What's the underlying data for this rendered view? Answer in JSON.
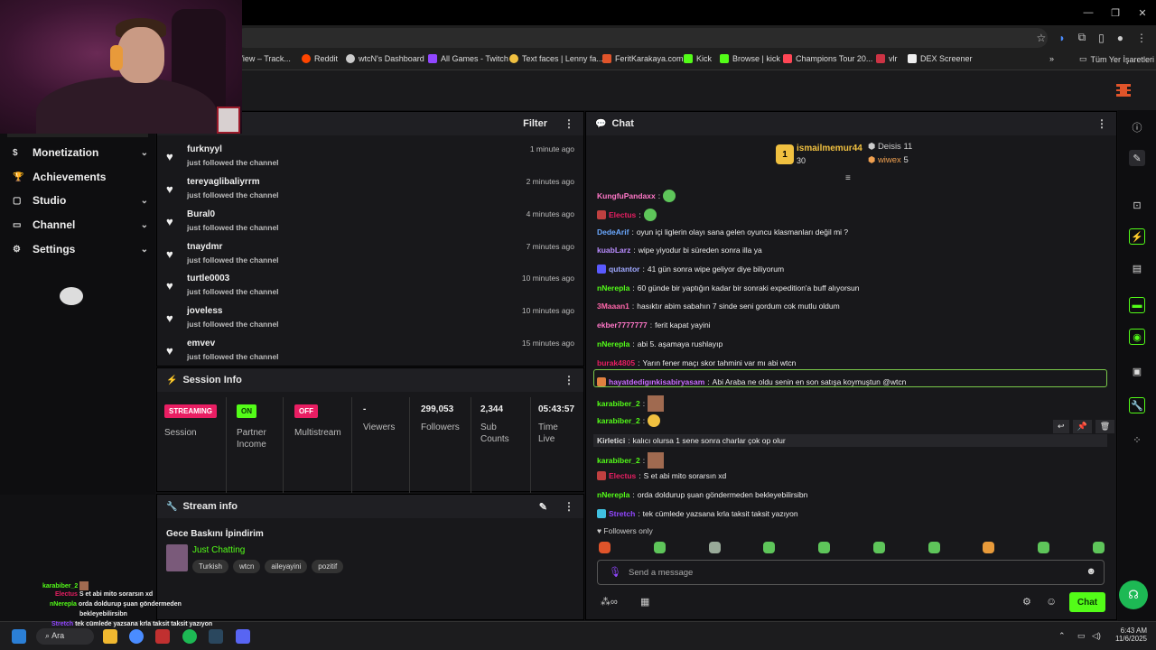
{
  "browser": {
    "bookmarks": [
      {
        "label": "gView – Track...",
        "color": "#888888"
      },
      {
        "label": "Reddit",
        "color": "#ff4500"
      },
      {
        "label": "wtcN's Dashboard",
        "color": "#ffffff"
      },
      {
        "label": "All Games - Twitch",
        "color": "#9146ff"
      },
      {
        "label": "Text faces | Lenny fa...",
        "color": "#f0c040"
      },
      {
        "label": "FeritKarakaya.com",
        "color": "#e0542a"
      },
      {
        "label": "Kick",
        "color": "#53fc18"
      },
      {
        "label": "Browse | kick",
        "color": "#53fc18"
      },
      {
        "label": "Champions Tour 20...",
        "color": "#ff4655"
      },
      {
        "label": "vlr",
        "color": "#cc3344"
      },
      {
        "label": "DEX Screener",
        "color": "#ffffff"
      }
    ],
    "all_bookmarks": "Tüm Yer İşaretleri"
  },
  "sidebar": {
    "items": [
      {
        "label": "Monetization",
        "icon": "dollar-icon",
        "has_chevron": true
      },
      {
        "label": "Achievements",
        "icon": "trophy-icon",
        "has_chevron": false
      },
      {
        "label": "Studio",
        "icon": "studio-icon",
        "has_chevron": true
      },
      {
        "label": "Channel",
        "icon": "channel-icon",
        "has_chevron": true
      },
      {
        "label": "Settings",
        "icon": "gear-icon",
        "has_chevron": true
      }
    ]
  },
  "activity": {
    "filter_label": "Filter",
    "items": [
      {
        "name": "furknyyl",
        "sub": "just followed the channel",
        "time": "1 minute ago"
      },
      {
        "name": "tereyaglibaliyrrm",
        "sub": "just followed the channel",
        "time": "2 minutes ago"
      },
      {
        "name": "Bural0",
        "sub": "just followed the channel",
        "time": "4 minutes ago"
      },
      {
        "name": "tnaydmr",
        "sub": "just followed the channel",
        "time": "7 minutes ago"
      },
      {
        "name": "turtle0003",
        "sub": "just followed the channel",
        "time": "10 minutes ago"
      },
      {
        "name": "joveless",
        "sub": "just followed the channel",
        "time": "10 minutes ago"
      },
      {
        "name": "emvev",
        "sub": "just followed the channel",
        "time": "15 minutes ago"
      }
    ]
  },
  "session": {
    "title": "Session Info",
    "cells": [
      {
        "value": "STREAMING",
        "label": "Session",
        "badge_color": "#e91e63"
      },
      {
        "value": "ON",
        "label": "Partner Income",
        "badge_color": "#53fc18"
      },
      {
        "value": "OFF",
        "label": "Multistream",
        "badge_color": "#e91e63"
      },
      {
        "value": "-",
        "label": "Viewers"
      },
      {
        "value": "299,053",
        "label": "Followers"
      },
      {
        "value": "2,344",
        "label": "Sub Counts"
      },
      {
        "value": "05:43:57",
        "label": "Time Live"
      }
    ]
  },
  "stream": {
    "title": "Stream info",
    "stream_title": "Gece Baskını İpindirim",
    "category": "Just Chatting",
    "tags": [
      "Turkish",
      "wtcn",
      "aileyayini",
      "pozitif"
    ]
  },
  "chat": {
    "title": "Chat",
    "leaderboard": {
      "first": {
        "name": "ismailmemur44",
        "count": "30",
        "rank": "1"
      },
      "second": {
        "name": "Deisis",
        "count": "11"
      },
      "third": {
        "name": "wiwex",
        "count": "5"
      }
    },
    "messages": [
      {
        "user": "KungfuPandaxx",
        "color": "#ff77c8",
        "text": "",
        "emote": "green"
      },
      {
        "user": "Electus",
        "color": "#e91e63",
        "text": "",
        "emote": "green",
        "badge": "#c04040"
      },
      {
        "user": "DedeArif",
        "color": "#6aa8ff",
        "text": "oyun içi liglerin olayı sana gelen oyuncu klasmanları değil mi ?"
      },
      {
        "user": "kuabLarz",
        "color": "#b98cff",
        "text": "wipe yiyodur bi süreden sonra illa ya"
      },
      {
        "user": "qutantor",
        "color": "#9fa8ff",
        "text": "41 gün sonra wipe geliyor diye biliyorum",
        "badge": "#5a5aff"
      },
      {
        "user": "nNerepla",
        "color": "#53fc18",
        "text": "60 günde bir yaptığın kadar bir sonraki expedition'a buff alıyorsun"
      },
      {
        "user": "3Maaan1",
        "color": "#ff66aa",
        "text": "hasıktır abim sabahın 7 sinde seni gordum cok mutlu oldum"
      },
      {
        "user": "ekber7777777",
        "color": "#ff77c8",
        "text": "ferit kapat yayini"
      },
      {
        "user": "nNerepla",
        "color": "#53fc18",
        "text": "abi 5. aşamaya rushlayıp"
      },
      {
        "user": "burak4805",
        "color": "#e91e63",
        "text": "Yarın fener maçı skor tahmini var mı abi wtcn"
      },
      {
        "user": "hayatdedigınkisabiryasam",
        "color": "#c86bff",
        "text": "Abi Araba ne oldu senin en son satışa koymuştun @wtcn",
        "highlight": true,
        "badge": "#e08040"
      },
      {
        "user": "karabiber_2",
        "color": "#53fc18",
        "text": "",
        "emote": "sq"
      },
      {
        "user": "karabiber_2",
        "color": "#53fc18",
        "text": "",
        "emote": "yellow"
      },
      {
        "user": "Kirletici",
        "color": "#dddddd",
        "text": "kalıcı olursa 1 sene sonra charlar çok op olur",
        "hover": true
      },
      {
        "user": "karabiber_2",
        "color": "#53fc18",
        "text": "",
        "emote": "sq"
      },
      {
        "user": "Electus",
        "color": "#e91e63",
        "text": "S et abi mito sorarsın xd",
        "badge": "#c04040"
      },
      {
        "user": "nNerepla",
        "color": "#53fc18",
        "text": "orda doldurup şuan göndermeden bekleyebilirsibn"
      },
      {
        "user": "Stretch",
        "color": "#9146ff",
        "text": "tek cümlede yazsana krla taksit taksit yazıyon",
        "badge": "#40c0e0"
      }
    ],
    "followers_only": "Followers only",
    "placeholder": "Send a message",
    "send_label": "Chat"
  },
  "overlay_chat": [
    {
      "user": "karabiber_2",
      "text": "",
      "color": "#53fc18"
    },
    {
      "user": "Electus",
      "text": "S et abi mito sorarsın xd",
      "color": "#e91e63"
    },
    {
      "user": "nNerepla",
      "text": "orda doldurup şuan göndermeden",
      "color": "#53fc18"
    },
    {
      "user": "",
      "text": "bekleyebilirsibn",
      "color": "#53fc18"
    },
    {
      "user": "Stretch",
      "text": "tek cümlede yazsana krla taksit taksit yazıyon",
      "color": "#9146ff"
    }
  ],
  "taskbar": {
    "search": "Ara",
    "time": "6:43 AM",
    "date": "11/6/2025"
  }
}
